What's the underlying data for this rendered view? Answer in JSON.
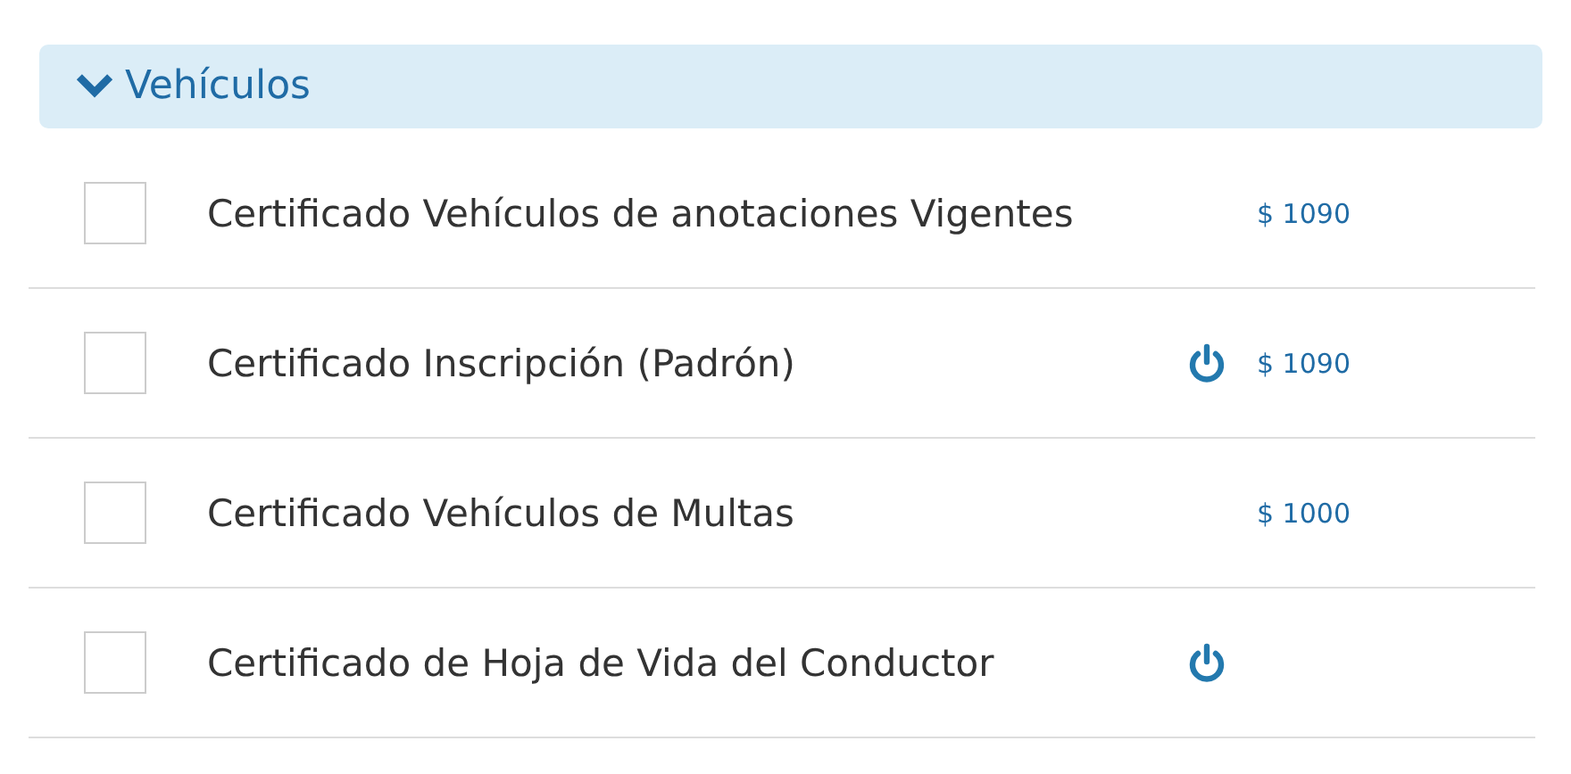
{
  "section": {
    "title": "Vehículos",
    "expanded": true,
    "items": [
      {
        "label": "Certificado Vehículos de anotaciones Vigentes",
        "checked": false,
        "power": false,
        "price": "$ 1090"
      },
      {
        "label": "Certificado Inscripción (Padrón)",
        "checked": false,
        "power": true,
        "price": "$ 1090"
      },
      {
        "label": "Certificado Vehículos de Multas",
        "checked": false,
        "power": false,
        "price": "$ 1000"
      },
      {
        "label": "Certificado de Hoja de Vida del Conductor",
        "checked": false,
        "power": true
      }
    ]
  }
}
